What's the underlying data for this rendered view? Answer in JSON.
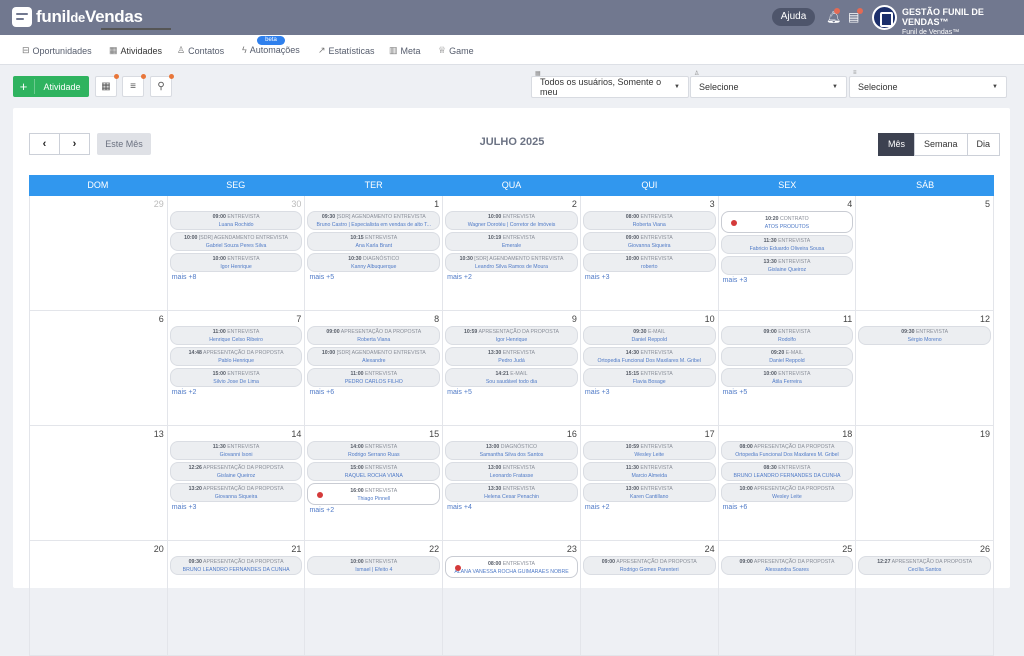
{
  "brand": {
    "logo_main": "funil",
    "logo_small": "de",
    "logo_end": "Vendas"
  },
  "header": {
    "help": "Ajuda",
    "account_name": "GESTÃO FUNIL DE VENDAS™",
    "account_sub": "Funil de Vendas™"
  },
  "nav": {
    "items": [
      {
        "label": "Oportunidades",
        "icon": "briefcase-icon"
      },
      {
        "label": "Atividades",
        "icon": "calendar-icon",
        "active": true
      },
      {
        "label": "Contatos",
        "icon": "user-icon"
      },
      {
        "label": "Automações",
        "icon": "bolt-icon",
        "badge": "beta"
      },
      {
        "label": "Estatísticas",
        "icon": "line-chart-icon"
      },
      {
        "label": "Meta",
        "icon": "bar-chart-icon"
      },
      {
        "label": "Game",
        "icon": "trophy-icon"
      }
    ]
  },
  "toolbar": {
    "add_label": "Atividade",
    "users_select": "Todos os usuários, Somente o meu",
    "select2": "Selecione",
    "select3": "Selecione"
  },
  "calendar": {
    "today": "Este Mês",
    "title": "JULHO 2025",
    "views": [
      "Mês",
      "Semana",
      "Dia"
    ],
    "active_view": "Mês",
    "weekdays": [
      "DOM",
      "SEG",
      "TER",
      "QUA",
      "QUI",
      "SEX",
      "SÁB"
    ],
    "weeks": [
      {
        "days": [
          {
            "num": "29",
            "muted": true,
            "events": []
          },
          {
            "num": "30",
            "muted": true,
            "events": [
              {
                "time": "09:00",
                "type": "ENTREVISTA",
                "name": "Luana Rochido"
              },
              {
                "time": "10:00",
                "type": "[SDR] AGENDAMENTO ENTREVISTA",
                "name": "Gabriel Souza Peres Silva"
              },
              {
                "time": "10:00",
                "type": "ENTREVISTA",
                "name": "Igor Henrique"
              }
            ],
            "more": "mais +8"
          },
          {
            "num": "1",
            "events": [
              {
                "time": "09:30",
                "type": "[SDR] AGENDAMENTO ENTREVISTA",
                "name": "Bruno Castro | Especialista em vendas de alto T..."
              },
              {
                "time": "10:15",
                "type": "ENTREVISTA",
                "name": "Ana Karla Brant"
              },
              {
                "time": "10:30",
                "type": "DIAGNÓSTICO",
                "name": "Kanny Albuquerque"
              }
            ],
            "more": "mais +5"
          },
          {
            "num": "2",
            "events": [
              {
                "time": "10:00",
                "type": "ENTREVISTA",
                "name": "Wagner Dorotéu | Corretor de Imóveis"
              },
              {
                "time": "10:19",
                "type": "ENTREVISTA",
                "name": "Emerale"
              },
              {
                "time": "10:30",
                "type": "[SDR] AGENDAMENTO ENTREVISTA",
                "name": "Leandro Silva Ramos de Moura"
              }
            ],
            "more": "mais +2"
          },
          {
            "num": "3",
            "events": [
              {
                "time": "08:00",
                "type": "ENTREVISTA",
                "name": "Roberta Viana"
              },
              {
                "time": "09:00",
                "type": "ENTREVISTA",
                "name": "Giovanna Siqueira"
              },
              {
                "time": "10:00",
                "type": "ENTREVISTA",
                "name": "roberto"
              }
            ],
            "more": "mais +3"
          },
          {
            "num": "4",
            "events": [
              {
                "time": "10:20",
                "type": "CONTRATO",
                "name": "ATOS PRODUTOS",
                "hl": true
              },
              {
                "time": "11:30",
                "type": "ENTREVISTA",
                "name": "Fabricio Eduardo Oliveira Sousa"
              },
              {
                "time": "13:30",
                "type": "ENTREVISTA",
                "name": "Gislaine Queiroz"
              }
            ],
            "more": "mais +3"
          },
          {
            "num": "5",
            "events": []
          }
        ]
      },
      {
        "days": [
          {
            "num": "6",
            "events": []
          },
          {
            "num": "7",
            "events": [
              {
                "time": "11:00",
                "type": "ENTREVISTA",
                "name": "Henrique Celso Ribeiro"
              },
              {
                "time": "14:48",
                "type": "APRESENTAÇÃO DA PROPOSTA",
                "name": "Pablo Henrique"
              },
              {
                "time": "15:00",
                "type": "ENTREVISTA",
                "name": "Silvio Jose De Lima"
              }
            ],
            "more": "mais +2"
          },
          {
            "num": "8",
            "events": [
              {
                "time": "09:00",
                "type": "APRESENTAÇÃO DA PROPOSTA",
                "name": "Roberta Viana"
              },
              {
                "time": "10:00",
                "type": "[SDR] AGENDAMENTO ENTREVISTA",
                "name": "Alexandre"
              },
              {
                "time": "11:00",
                "type": "ENTREVISTA",
                "name": "PEDRO CARLOS FILHO"
              }
            ],
            "more": "mais +6"
          },
          {
            "num": "9",
            "events": [
              {
                "time": "10:59",
                "type": "APRESENTAÇÃO DA PROPOSTA",
                "name": "Igor Henrique"
              },
              {
                "time": "13:30",
                "type": "ENTREVISTA",
                "name": "Pedro Judá"
              },
              {
                "time": "14:21",
                "type": "E-MAIL",
                "name": "Sou saudável todo dia"
              }
            ],
            "more": "mais +5"
          },
          {
            "num": "10",
            "events": [
              {
                "time": "09:30",
                "type": "E-MAIL",
                "name": "Daniel Reppold"
              },
              {
                "time": "14:30",
                "type": "ENTREVISTA",
                "name": "Ortopedia Funcional Dos Maxilares M. Gribel"
              },
              {
                "time": "15:15",
                "type": "ENTREVISTA",
                "name": "Flavia Bosage"
              }
            ],
            "more": "mais +3"
          },
          {
            "num": "11",
            "events": [
              {
                "time": "09:00",
                "type": "ENTREVISTA",
                "name": "Rodolfo"
              },
              {
                "time": "09:20",
                "type": "E-MAIL",
                "name": "Daniel Reppold"
              },
              {
                "time": "10:00",
                "type": "ENTREVISTA",
                "name": "Átila Ferreira"
              }
            ],
            "more": "mais +5"
          },
          {
            "num": "12",
            "events": [
              {
                "time": "09:30",
                "type": "ENTREVISTA",
                "name": "Sérgio Moreno"
              }
            ]
          }
        ]
      },
      {
        "days": [
          {
            "num": "13",
            "events": []
          },
          {
            "num": "14",
            "events": [
              {
                "time": "11:30",
                "type": "ENTREVISTA",
                "name": "Giovanni Isoni"
              },
              {
                "time": "12:26",
                "type": "APRESENTAÇÃO DA PROPOSTA",
                "name": "Gislaine Queiroz"
              },
              {
                "time": "13:20",
                "type": "APRESENTAÇÃO DA PROPOSTA",
                "name": "Giovanna Siqueira"
              }
            ],
            "more": "mais +3"
          },
          {
            "num": "15",
            "events": [
              {
                "time": "14:00",
                "type": "ENTREVISTA",
                "name": "Rodrigo Serrano Ruas"
              },
              {
                "time": "15:00",
                "type": "ENTREVISTA",
                "name": "RAQUEL ROCHA VIANA"
              },
              {
                "time": "16:00",
                "type": "ENTREVISTA",
                "name": "Thiago Pinnell",
                "hl": true
              }
            ],
            "more": "mais +2"
          },
          {
            "num": "16",
            "events": [
              {
                "time": "13:00",
                "type": "DIAGNÓSTICO",
                "name": "Samantha Silva dos Santos"
              },
              {
                "time": "13:00",
                "type": "ENTREVISTA",
                "name": "Leonardo Fratasse"
              },
              {
                "time": "13:30",
                "type": "ENTREVISTA",
                "name": "Helena Cesar Penachin"
              }
            ],
            "more": "mais +4"
          },
          {
            "num": "17",
            "events": [
              {
                "time": "10:59",
                "type": "ENTREVISTA",
                "name": "Wesley Leite"
              },
              {
                "time": "11:30",
                "type": "ENTREVISTA",
                "name": "Marcio Almeida"
              },
              {
                "time": "13:00",
                "type": "ENTREVISTA",
                "name": "Karen Cantillano"
              }
            ],
            "more": "mais +2"
          },
          {
            "num": "18",
            "events": [
              {
                "time": "08:00",
                "type": "APRESENTAÇÃO DA PROPOSTA",
                "name": "Ortopedia Funcional Dos Maxilares M. Gribel"
              },
              {
                "time": "08:30",
                "type": "ENTREVISTA",
                "name": "BRUNO LEANDRO FERNANDES DA CUNHA"
              },
              {
                "time": "10:00",
                "type": "APRESENTAÇÃO DA PROPOSTA",
                "name": "Wesley Leite"
              }
            ],
            "more": "mais +6"
          },
          {
            "num": "19",
            "events": []
          }
        ]
      },
      {
        "days": [
          {
            "num": "20",
            "events": []
          },
          {
            "num": "21",
            "events": [
              {
                "time": "09:30",
                "type": "APRESENTAÇÃO DA PROPOSTA",
                "name": "BRUNO LEANDRO FERNANDES DA CUNHA"
              }
            ]
          },
          {
            "num": "22",
            "events": [
              {
                "time": "10:00",
                "type": "ENTREVISTA",
                "name": "Ismael | Efeito 4"
              }
            ]
          },
          {
            "num": "23",
            "events": [
              {
                "time": "08:00",
                "type": "ENTREVISTA",
                "name": "ALANA VANESSA ROCHA GUIMARAES NOBRE",
                "hl": true
              }
            ]
          },
          {
            "num": "24",
            "events": [
              {
                "time": "09:00",
                "type": "APRESENTAÇÃO DA PROPOSTA",
                "name": "Rodrigo Gomes Parenteri"
              }
            ]
          },
          {
            "num": "25",
            "events": [
              {
                "time": "09:00",
                "type": "APRESENTAÇÃO DA PROPOSTA",
                "name": "Alessandra Soares"
              }
            ]
          },
          {
            "num": "26",
            "events": [
              {
                "time": "12:27",
                "type": "APRESENTAÇÃO DA PROPOSTA",
                "name": "Cecília Santos"
              }
            ]
          }
        ]
      }
    ]
  }
}
